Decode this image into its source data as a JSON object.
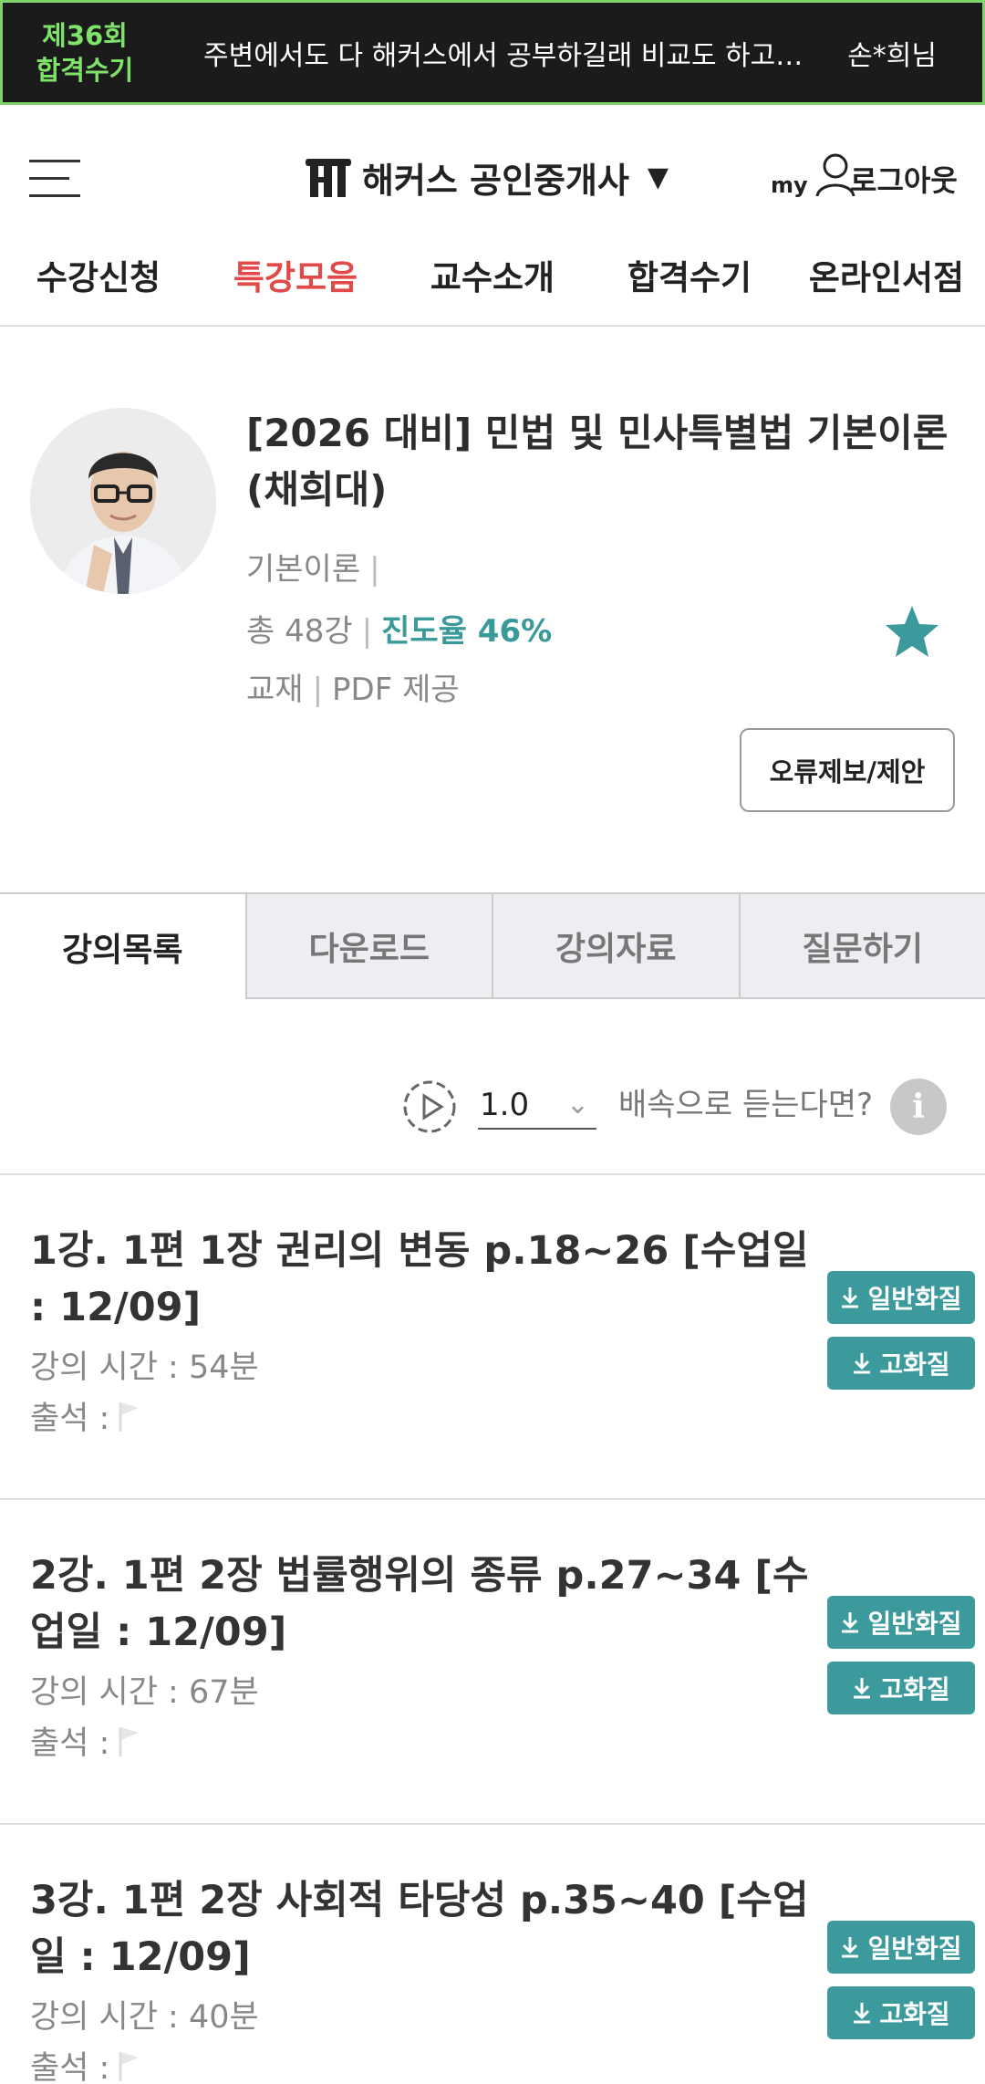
{
  "banner": {
    "tag_line1": "제36회",
    "tag_line2": "합격수기",
    "review_text": "주변에서도 다 해커스에서 공부하길래 비교도 하고 결정했어요",
    "author": "손*희님"
  },
  "header": {
    "brand": "해커스 공인중개사",
    "caret": "▼",
    "my_label": "my",
    "logout": "로그아웃"
  },
  "nav": {
    "items": [
      "수강신청",
      "특강모음",
      "교수소개",
      "합격수기",
      "온라인서점"
    ],
    "active_index": 1,
    "active_color": "#e24a4a"
  },
  "course": {
    "title": "[2026 대비] 민법 및 민사특별법 기본이론 (채희대)",
    "category": "기본이론",
    "total_label": "총 48강",
    "progress_label": "진도율 46%",
    "progress_value": 46,
    "material_label": "교재",
    "material_value": "PDF 제공",
    "favorite_icon": "star-icon",
    "report_button": "오류제보/제안"
  },
  "tabs": {
    "items": [
      "강의목록",
      "다운로드",
      "강의자료",
      "질문하기"
    ],
    "active_index": 0
  },
  "speed": {
    "value": "1.0",
    "hint": "배속으로 듣는다면?",
    "info": "i"
  },
  "lectures": [
    {
      "title": "1강. 1편 1장 권리의 변동 p.18~26 [수업일 : 12/09]",
      "time": "강의 시간 : 54분",
      "attendance": "출석 :",
      "btn_normal": "일반화질",
      "btn_high": "고화질"
    },
    {
      "title": "2강. 1편 2장 법률행위의 종류 p.27~34 [수업일 : 12/09]",
      "time": "강의 시간 : 67분",
      "attendance": "출석 :",
      "btn_normal": "일반화질",
      "btn_high": "고화질"
    },
    {
      "title": "3강. 1편 2장 사회적 타당성 p.35~40 [수업일 : 12/09]",
      "time": "강의 시간 : 40분",
      "attendance": "출석 :",
      "btn_normal": "일반화질",
      "btn_high": "고화질"
    }
  ],
  "colors": {
    "accent": "#3d9a9c",
    "banner_bg": "#1b1b1b",
    "banner_green": "#7fe36a"
  }
}
